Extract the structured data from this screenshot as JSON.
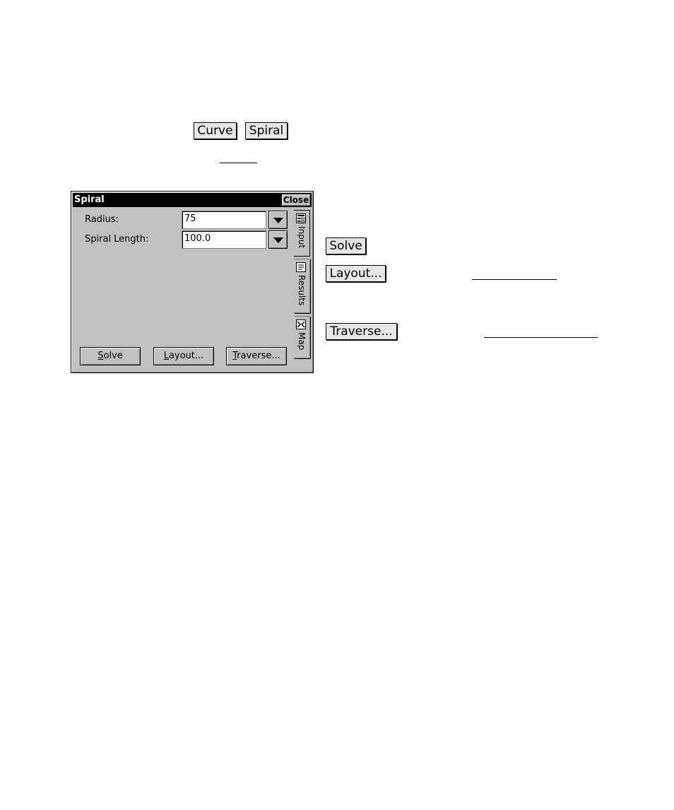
{
  "doc": {
    "curve_button": "Curve",
    "spiral_button": "Spiral",
    "solve_button": "Solve",
    "layout_button": "Layout...",
    "traverse_button": "Traverse..."
  },
  "window": {
    "title": "Spiral",
    "close_label": "Close",
    "fields": [
      {
        "label": "Radius:",
        "value": "75"
      },
      {
        "label": "Spiral Length:",
        "value": "100.0"
      }
    ],
    "buttons": {
      "solve_mnemonic": "S",
      "solve_rest": "olve",
      "layout_mnemonic": "L",
      "layout_rest": "ayout...",
      "traverse_mnemonic": "T",
      "traverse_rest": "raverse..."
    },
    "tabs": [
      {
        "label": "Input",
        "icon": "input-form-icon",
        "active": true
      },
      {
        "label": "Results",
        "icon": "results-document-icon",
        "active": false
      },
      {
        "label": "Map",
        "icon": "map-icon",
        "active": false
      }
    ]
  }
}
